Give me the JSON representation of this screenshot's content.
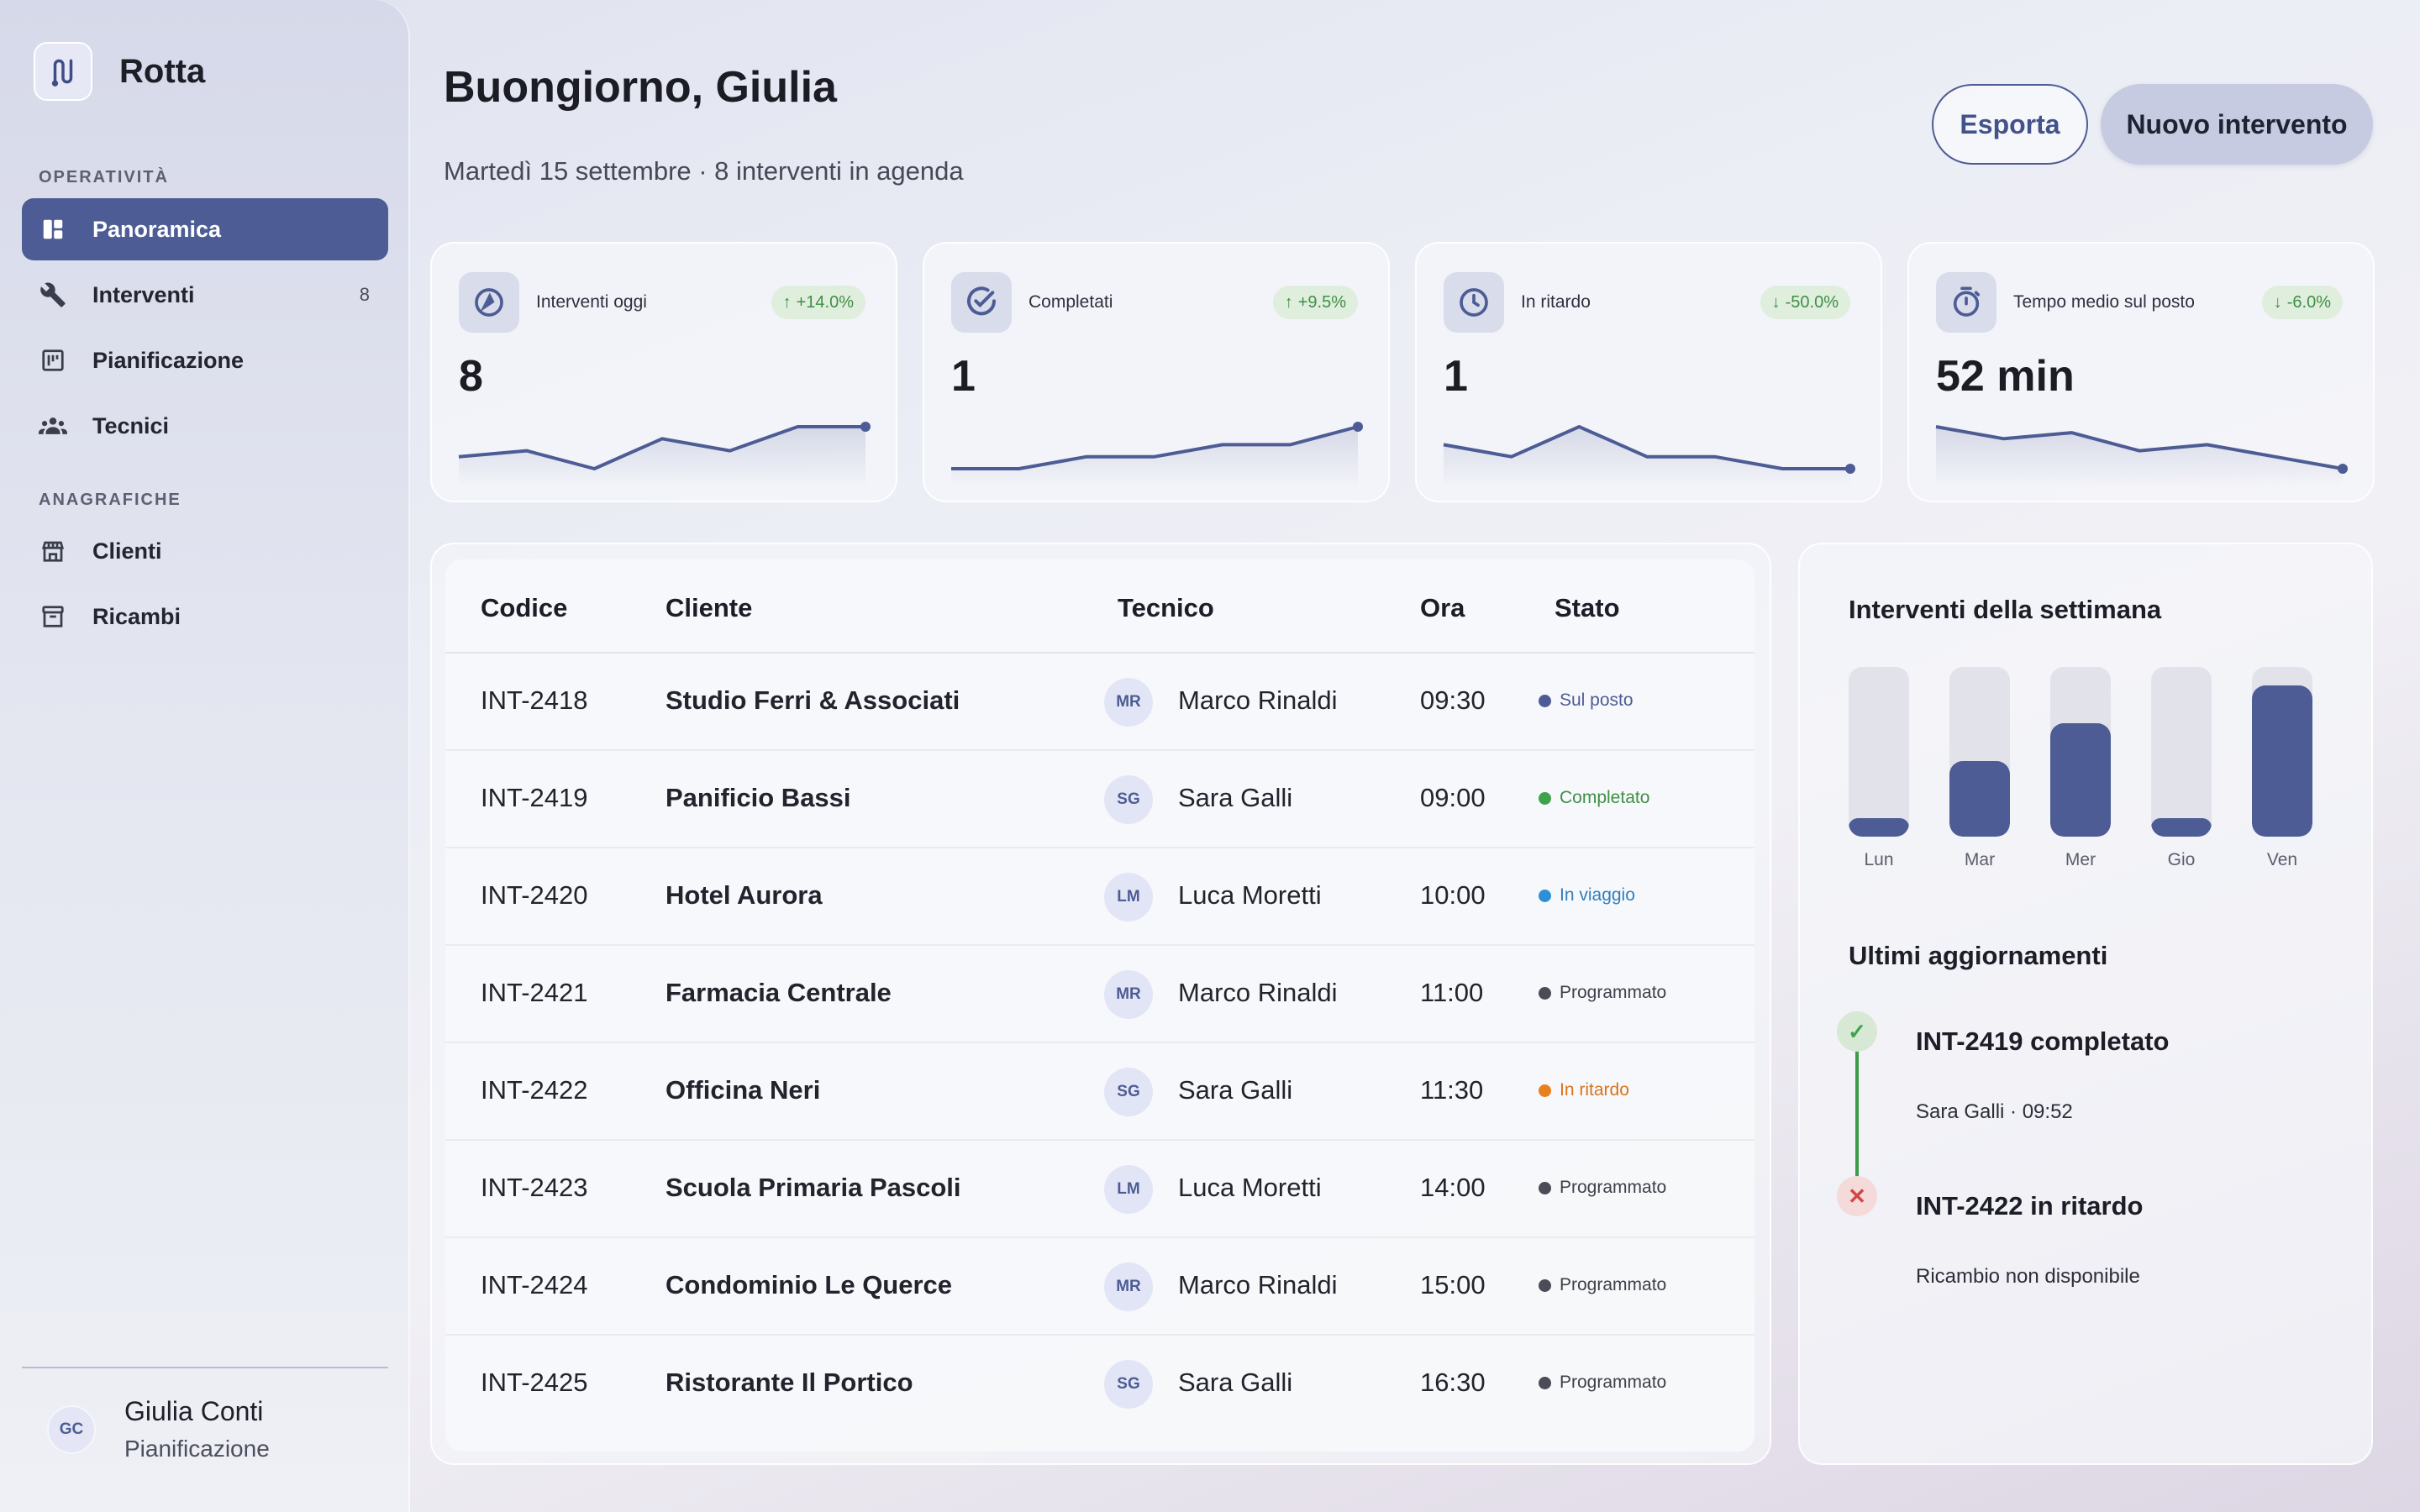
{
  "app": {
    "name": "Rotta"
  },
  "sidebar": {
    "sections": [
      {
        "label": "OPERATIVITÀ"
      },
      {
        "label": "ANAGRAFICHE"
      }
    ],
    "items": [
      {
        "label": "Panoramica",
        "icon": "dashboard-icon",
        "active": true
      },
      {
        "label": "Interventi",
        "icon": "wrench-icon",
        "count": "8"
      },
      {
        "label": "Pianificazione",
        "icon": "calendar-icon"
      },
      {
        "label": "Tecnici",
        "icon": "group-icon"
      },
      {
        "label": "Clienti",
        "icon": "store-icon"
      },
      {
        "label": "Ricambi",
        "icon": "archive-icon"
      }
    ],
    "user": {
      "initials": "GC",
      "name": "Giulia Conti",
      "role": "Pianificazione"
    }
  },
  "header": {
    "greeting": "Buongiorno, Giulia",
    "subtitle": "Martedì 15 settembre · 8 interventi in agenda",
    "export_label": "Esporta",
    "new_label": "Nuovo intervento"
  },
  "kpis": [
    {
      "label": "Interventi oggi",
      "value": "8",
      "delta": "+14.0%",
      "direction": "up",
      "icon": "target-icon",
      "trend": [
        3,
        4,
        1,
        6,
        4,
        8,
        8
      ]
    },
    {
      "label": "Completati",
      "value": "1",
      "delta": "+9.5%",
      "direction": "up",
      "icon": "check-circle-icon",
      "trend": [
        1,
        1,
        3,
        3,
        5,
        5,
        8
      ]
    },
    {
      "label": "In ritardo",
      "value": "1",
      "delta": "-50.0%",
      "direction": "down",
      "icon": "clock-icon",
      "trend": [
        5,
        3,
        8,
        3,
        3,
        1,
        1
      ]
    },
    {
      "label": "Tempo medio sul posto",
      "value": "52 min",
      "delta": "-6.0%",
      "direction": "down",
      "icon": "stopwatch-icon",
      "trend": [
        8,
        6,
        7,
        4,
        5,
        3,
        1
      ]
    }
  ],
  "table": {
    "headers": {
      "code": "Codice",
      "client": "Cliente",
      "tech": "Tecnico",
      "time": "Ora",
      "status": "Stato"
    },
    "rows": [
      {
        "code": "INT-2418",
        "client": "Studio Ferri & Associati",
        "initials": "MR",
        "tech": "Marco Rinaldi",
        "time": "09:30",
        "status": "Sul posto",
        "status_color": "#4d5c94",
        "text_color": "#4d5c94"
      },
      {
        "code": "INT-2419",
        "client": "Panificio Bassi",
        "initials": "SG",
        "tech": "Sara Galli",
        "time": "09:00",
        "status": "Completato",
        "status_color": "#3fa24c",
        "text_color": "#3f8f47"
      },
      {
        "code": "INT-2420",
        "client": "Hotel Aurora",
        "initials": "LM",
        "tech": "Luca Moretti",
        "time": "10:00",
        "status": "In viaggio",
        "status_color": "#2f8fd6",
        "text_color": "#2f7fc0"
      },
      {
        "code": "INT-2421",
        "client": "Farmacia Centrale",
        "initials": "MR",
        "tech": "Marco Rinaldi",
        "time": "11:00",
        "status": "Programmato",
        "status_color": "#4a4c56",
        "text_color": "#3e404a"
      },
      {
        "code": "INT-2422",
        "client": "Officina Neri",
        "initials": "SG",
        "tech": "Sara Galli",
        "time": "11:30",
        "status": "In ritardo",
        "status_color": "#e8801e",
        "text_color": "#d8741a"
      },
      {
        "code": "INT-2423",
        "client": "Scuola Primaria Pascoli",
        "initials": "LM",
        "tech": "Luca Moretti",
        "time": "14:00",
        "status": "Programmato",
        "status_color": "#4a4c56",
        "text_color": "#3e404a"
      },
      {
        "code": "INT-2424",
        "client": "Condominio Le Querce",
        "initials": "MR",
        "tech": "Marco Rinaldi",
        "time": "15:00",
        "status": "Programmato",
        "status_color": "#4a4c56",
        "text_color": "#3e404a"
      },
      {
        "code": "INT-2425",
        "client": "Ristorante Il Portico",
        "initials": "SG",
        "tech": "Sara Galli",
        "time": "16:30",
        "status": "Programmato",
        "status_color": "#4a4c56",
        "text_color": "#3e404a"
      }
    ]
  },
  "weekly": {
    "title": "Interventi della settimana",
    "chart_data": {
      "type": "bar",
      "categories": [
        "Lun",
        "Mar",
        "Mer",
        "Gio",
        "Ven"
      ],
      "values": [
        1,
        4,
        6,
        1,
        8
      ],
      "ylim": [
        0,
        9
      ]
    }
  },
  "updates": {
    "title": "Ultimi aggiornamenti",
    "items": [
      {
        "title": "INT-2419 completato",
        "sub": "Sara Galli · 09:52",
        "kind": "success",
        "icon": "check-icon"
      },
      {
        "title": "INT-2422 in ritardo",
        "sub": "Ricambio non disponibile",
        "kind": "error",
        "icon": "close-icon"
      }
    ]
  },
  "colors": {
    "accent": "#4d5c94",
    "success": "#3fa24c",
    "warning": "#e8801e",
    "info": "#2f8fd6"
  }
}
